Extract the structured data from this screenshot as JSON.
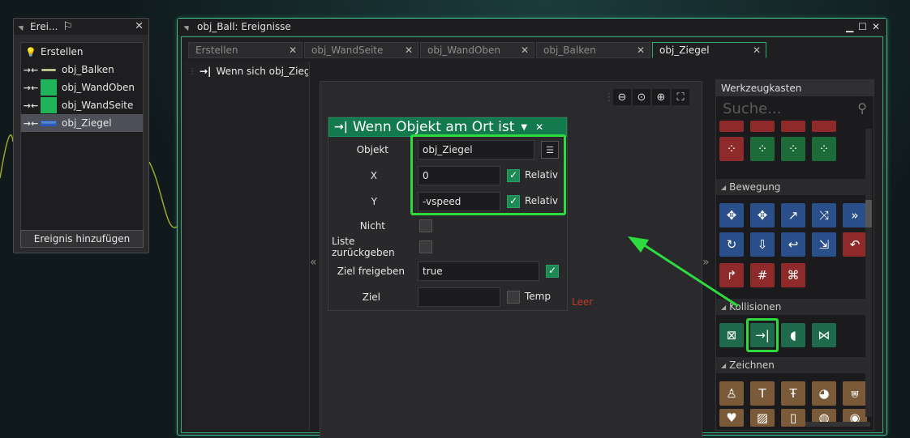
{
  "events_panel": {
    "title": "Erei...",
    "items": [
      {
        "label": "Erstellen",
        "icon": "lightbulb-icon"
      },
      {
        "label": "obj_Balken",
        "icon": "collision-icon"
      },
      {
        "label": "obj_WandOben",
        "icon": "collision-icon"
      },
      {
        "label": "obj_WandSeite",
        "icon": "collision-icon"
      },
      {
        "label": "obj_Ziegel",
        "icon": "collision-icon"
      }
    ],
    "add_button": "Ereignis hinzufügen"
  },
  "main_window": {
    "title": "obj_Ball: Ereignisse",
    "tabs": [
      "Erstellen",
      "obj_WandSeite",
      "obj_WandOben",
      "obj_Balken",
      "obj_Ziegel"
    ],
    "active_tab": "obj_Ziegel",
    "event_item": "Wenn sich obj_Ziegel"
  },
  "node": {
    "title": "Wenn Objekt am Ort ist",
    "objekt_label": "Objekt",
    "objekt_value": "obj_Ziegel",
    "x_label": "X",
    "x_value": "0",
    "x_relativ": "Relativ",
    "y_label": "Y",
    "y_value": "-vspeed",
    "y_relativ": "Relativ",
    "nicht_label": "Nicht",
    "liste_label": "Liste zurückgeben",
    "ziel_freigeben_label": "Ziel freigeben",
    "ziel_freigeben_value": "true",
    "ziel_label": "Ziel",
    "temp_label": "Temp"
  },
  "canvas": {
    "leer_text": "Leer"
  },
  "toolbox": {
    "title": "Werkzeugkasten",
    "search_placeholder": "Suche...",
    "sections": [
      "Bewegung",
      "Kollisionen",
      "Zeichnen"
    ]
  },
  "colors": {
    "accent_green": "#2edb3e",
    "node_header": "#127a4d",
    "leer_red": "#c03a2b"
  }
}
